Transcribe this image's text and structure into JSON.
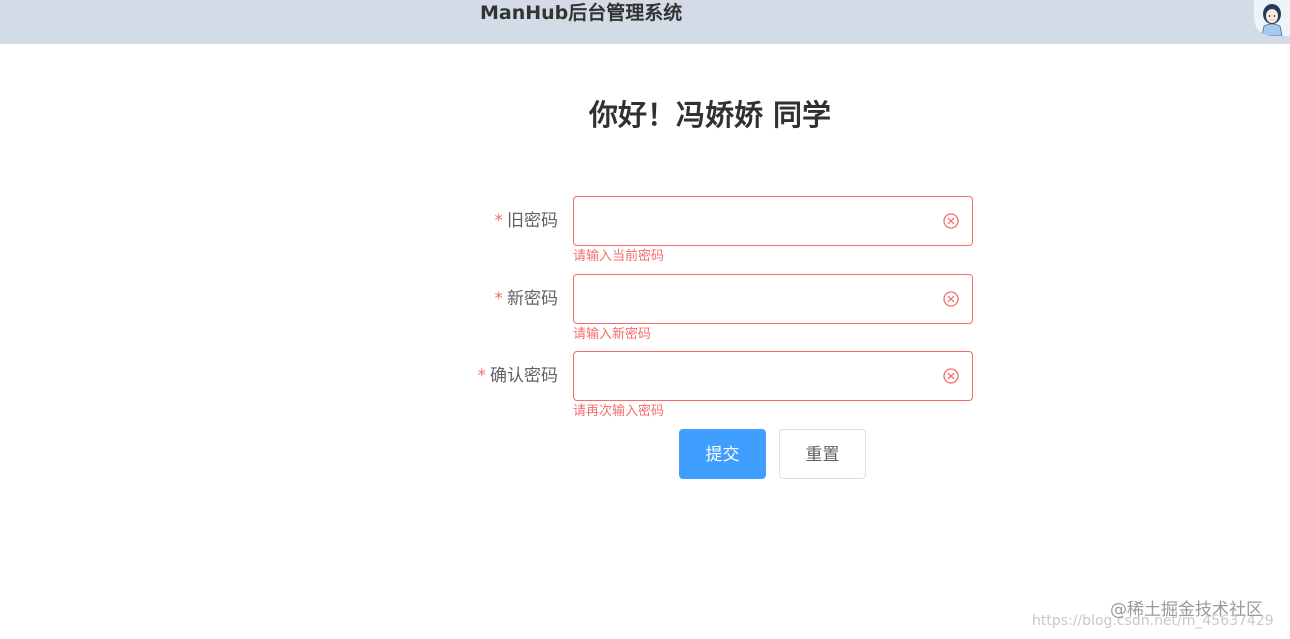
{
  "header": {
    "app_title": "ManHub后台管理系统"
  },
  "greeting": "你好！冯娇娇 同学",
  "form": {
    "required_mark": "*",
    "fields": [
      {
        "label": "旧密码",
        "value": "",
        "error": "请输入当前密码"
      },
      {
        "label": "新密码",
        "value": "",
        "error": "请输入新密码"
      },
      {
        "label": "确认密码",
        "value": "",
        "error": "请再次输入密码"
      }
    ],
    "submit_label": "提交",
    "reset_label": "重置"
  },
  "watermark": {
    "main": "@稀土掘金技术社区",
    "faint": "https://blog.csdn.net/m_45637429"
  },
  "colors": {
    "header_bg": "#d3dce6",
    "error": "#f56c6c",
    "primary": "#409eff"
  },
  "icons": {
    "avatar": "avatar-girl-icon",
    "clear": "circle-close-icon"
  }
}
